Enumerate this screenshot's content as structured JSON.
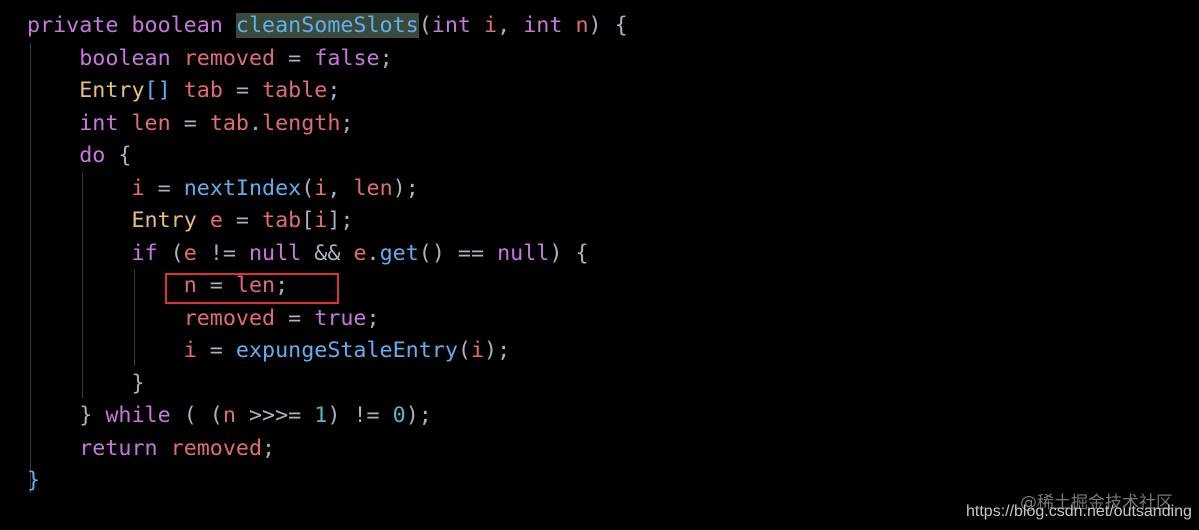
{
  "colors": {
    "keyword": "#c678dd",
    "variable": "#e06c75",
    "function": "#61afef",
    "type": "#e5c07b",
    "punctuation": "#abb2bf",
    "highlight_box": "#e03030"
  },
  "code_lines": [
    [
      [
        "private boolean ",
        "kw"
      ],
      [
        "cleanSomeSlots",
        "fn hl"
      ],
      [
        "(",
        "pu"
      ],
      [
        "int ",
        "kw"
      ],
      [
        "i",
        "var"
      ],
      [
        ", ",
        "pu"
      ],
      [
        "int ",
        "kw"
      ],
      [
        "n",
        "var"
      ],
      [
        ") {",
        "pu"
      ]
    ],
    [
      [
        "    ",
        "pu"
      ],
      [
        "boolean ",
        "kw"
      ],
      [
        "removed",
        "var"
      ],
      [
        " = ",
        "pu"
      ],
      [
        "false",
        "kw"
      ],
      [
        ";",
        "pu"
      ]
    ],
    [
      [
        "    ",
        "pu"
      ],
      [
        "Entry",
        "ty"
      ],
      [
        "[]",
        "br"
      ],
      [
        " ",
        "pu"
      ],
      [
        "tab",
        "var"
      ],
      [
        " = ",
        "pu"
      ],
      [
        "table",
        "var"
      ],
      [
        ";",
        "pu"
      ]
    ],
    [
      [
        "    ",
        "pu"
      ],
      [
        "int ",
        "kw"
      ],
      [
        "len",
        "var"
      ],
      [
        " = ",
        "pu"
      ],
      [
        "tab",
        "var"
      ],
      [
        ".",
        "pu"
      ],
      [
        "length",
        "var"
      ],
      [
        ";",
        "pu"
      ]
    ],
    [
      [
        "    ",
        "pu"
      ],
      [
        "do ",
        "kw"
      ],
      [
        "{",
        "pu"
      ]
    ],
    [
      [
        "        ",
        "pu"
      ],
      [
        "i",
        "var"
      ],
      [
        " = ",
        "pu"
      ],
      [
        "nextIndex",
        "fn"
      ],
      [
        "(",
        "pu"
      ],
      [
        "i",
        "var"
      ],
      [
        ", ",
        "pu"
      ],
      [
        "len",
        "var"
      ],
      [
        ");",
        "pu"
      ]
    ],
    [
      [
        "        ",
        "pu"
      ],
      [
        "Entry ",
        "ty"
      ],
      [
        "e",
        "var"
      ],
      [
        " = ",
        "pu"
      ],
      [
        "tab",
        "var"
      ],
      [
        "[",
        "pu"
      ],
      [
        "i",
        "var"
      ],
      [
        "];",
        "pu"
      ]
    ],
    [
      [
        "        ",
        "pu"
      ],
      [
        "if ",
        "kw"
      ],
      [
        "(",
        "pu"
      ],
      [
        "e",
        "var"
      ],
      [
        " != ",
        "pu"
      ],
      [
        "null ",
        "kw"
      ],
      [
        "&& ",
        "pu"
      ],
      [
        "e",
        "var"
      ],
      [
        ".",
        "pu"
      ],
      [
        "get",
        "fn"
      ],
      [
        "() == ",
        "pu"
      ],
      [
        "null",
        "kw"
      ],
      [
        ") {",
        "pu"
      ]
    ],
    [
      [
        "            ",
        "pu"
      ],
      [
        "n",
        "var"
      ],
      [
        " = ",
        "pu"
      ],
      [
        "len",
        "var"
      ],
      [
        ";",
        "pu"
      ]
    ],
    [
      [
        "            ",
        "pu"
      ],
      [
        "removed",
        "var"
      ],
      [
        " = ",
        "pu"
      ],
      [
        "true",
        "kw"
      ],
      [
        ";",
        "pu"
      ]
    ],
    [
      [
        "            ",
        "pu"
      ],
      [
        "i",
        "var"
      ],
      [
        " = ",
        "pu"
      ],
      [
        "expungeStaleEntry",
        "fn"
      ],
      [
        "(",
        "pu"
      ],
      [
        "i",
        "var"
      ],
      [
        ");",
        "pu"
      ]
    ],
    [
      [
        "        }",
        "pu"
      ]
    ],
    [
      [
        "    } ",
        "pu"
      ],
      [
        "while ",
        "kw"
      ],
      [
        "( (",
        "pu"
      ],
      [
        "n",
        "var"
      ],
      [
        " >>>= ",
        "pu"
      ],
      [
        "1",
        "num"
      ],
      [
        ") != ",
        "pu"
      ],
      [
        "0",
        "num"
      ],
      [
        ");",
        "pu"
      ]
    ],
    [
      [
        "    ",
        "pu"
      ],
      [
        "return ",
        "kw"
      ],
      [
        "removed",
        "var"
      ],
      [
        ";",
        "pu"
      ]
    ],
    [
      [
        "}",
        "fn"
      ]
    ]
  ],
  "watermark": {
    "site": "@稀土掘金技术社区",
    "url": "https://blog.csdn.net/outsanding"
  }
}
